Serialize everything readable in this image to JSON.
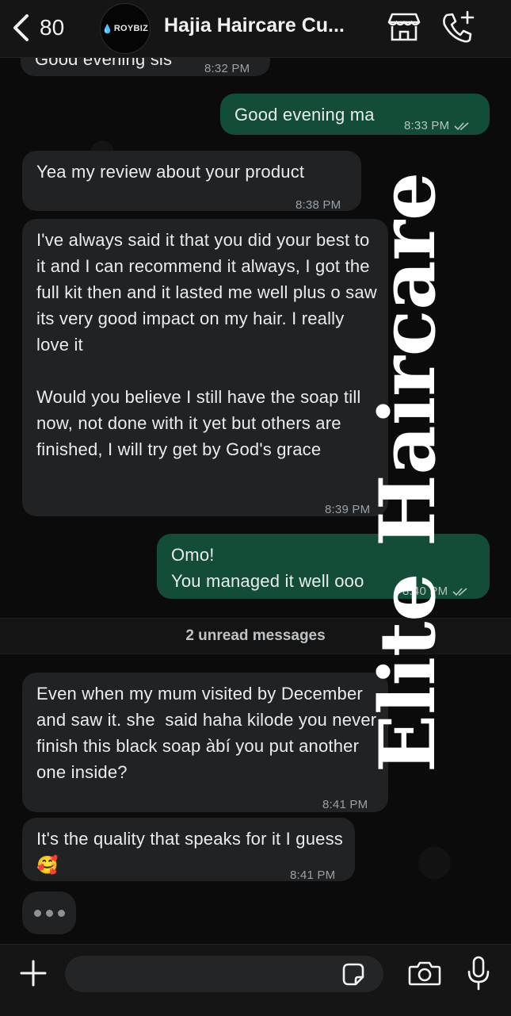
{
  "header": {
    "back_count": "80",
    "avatar_text": "ROYBIZ",
    "title": "Hajia Haircare Cu...",
    "icons": [
      "chevron-left-icon",
      "store-icon",
      "phone-add-icon"
    ]
  },
  "messages": [
    {
      "dir": "in",
      "text": "Good evening sis",
      "time": "8:32 PM"
    },
    {
      "dir": "out",
      "text": "Good evening ma",
      "time": "8:33 PM",
      "status": "read"
    },
    {
      "dir": "in",
      "text": "Yea my review about your product",
      "time": "8:38 PM"
    },
    {
      "dir": "in",
      "text": "I've always said it that you did your best to it and I can recommend it always, I got the full kit then and it lasted me well plus o saw its very good impact on my hair. I really love it\n\nWould you believe I still have the soap till now, not done with it yet but others are finished, I will try get by God's grace",
      "time": "8:39 PM"
    },
    {
      "dir": "out",
      "text": "Omo!\nYou managed it well ooo",
      "time": "8:40 PM",
      "status": "read"
    },
    {
      "dir": "in",
      "text": "Even when my mum visited by December and saw it. she  said haha kilode you never finish this black soap àbí you put another one inside?",
      "time": "8:41 PM"
    },
    {
      "dir": "in",
      "text": "It's the quality that speaks for it I guess 🥰",
      "time": "8:41 PM"
    }
  ],
  "unread_divider": "2 unread messages",
  "watermark": "Elite Haircare",
  "composer": {
    "placeholder": "",
    "icons": [
      "plus-icon",
      "sticker-icon",
      "camera-icon",
      "microphone-icon"
    ]
  },
  "colors": {
    "background": "#0b0b0b",
    "incoming_bubble": "#202224",
    "outgoing_bubble": "#134d37",
    "header": "#151515"
  }
}
